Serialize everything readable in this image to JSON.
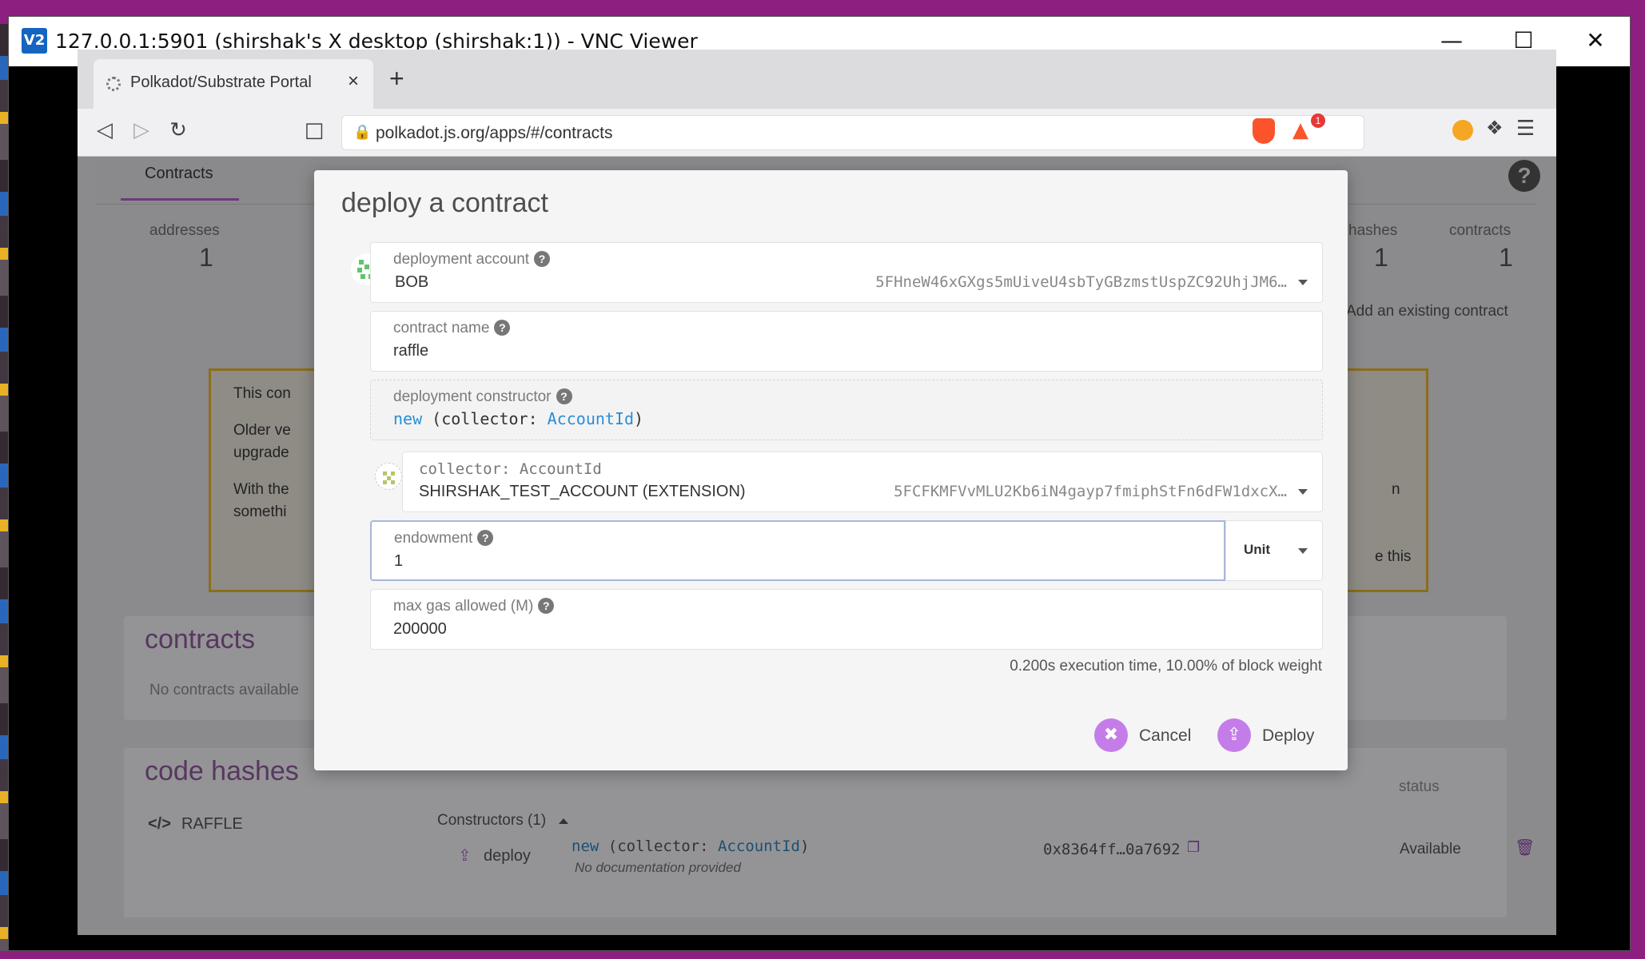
{
  "vnc": {
    "logo": "V2",
    "title": "127.0.0.1:5901 (shirshak's X desktop (shirshak:1)) - VNC Viewer",
    "minimize_icon": "minimize-icon",
    "maximize_icon": "maximize-icon",
    "close_icon": "close-icon"
  },
  "browser": {
    "tab_title": "Polkadot/Substrate Portal",
    "url": "polkadot.js.org/apps/#/contracts",
    "badge": "1"
  },
  "page": {
    "subnav_tab": "Contracts",
    "stats": {
      "addresses_label": "addresses",
      "addresses_value": "1",
      "hashes_label": "hashes",
      "hashes_value": "1",
      "contracts_label": "contracts",
      "contracts_value": "1"
    },
    "add_existing": "Add an existing contract",
    "warning": {
      "line1": "This con",
      "line2": "Older ve",
      "line3": "upgrade",
      "line4": "With the",
      "line5": "somethi",
      "right1": "n",
      "right2": "e this"
    },
    "contracts_title": "contracts",
    "no_contracts": "No contracts available",
    "code_hashes_title": "code hashes",
    "status_header": "status",
    "code_row": {
      "name": "RAFFLE",
      "constructors": "Constructors (1)",
      "deploy_label": "deploy",
      "sig_new": "new",
      "sig_open": " (collector: ",
      "sig_type": "AccountId",
      "sig_close": ")",
      "no_docs": "No documentation provided",
      "hash": "0x8364ff…0a7692",
      "status": "Available"
    }
  },
  "modal": {
    "title": "deploy a contract",
    "deployment_account": {
      "label": "deployment account",
      "value": "BOB",
      "address": "5FHneW46xGXgs5mUiveU4sbTyGBzmstUspZC92UhjJM6…"
    },
    "contract_name": {
      "label": "contract name",
      "value": "raffle"
    },
    "constructor": {
      "label": "deployment constructor",
      "kw": "new",
      "open": " (collector: ",
      "type": "AccountId",
      "close": ")"
    },
    "collector": {
      "label": "collector: AccountId",
      "value": "SHIRSHAK_TEST_ACCOUNT (EXTENSION)",
      "address": "5FCFKMFVvMLU2Kb6iN4gayp7fmiphStFn6dFW1dxcX…"
    },
    "endowment": {
      "label": "endowment",
      "value": "1",
      "unit": "Unit"
    },
    "max_gas": {
      "label": "max gas allowed (M)",
      "value": "200000"
    },
    "gas_info": "0.200s execution time, 10.00% of block weight",
    "cancel": "Cancel",
    "deploy": "Deploy"
  }
}
